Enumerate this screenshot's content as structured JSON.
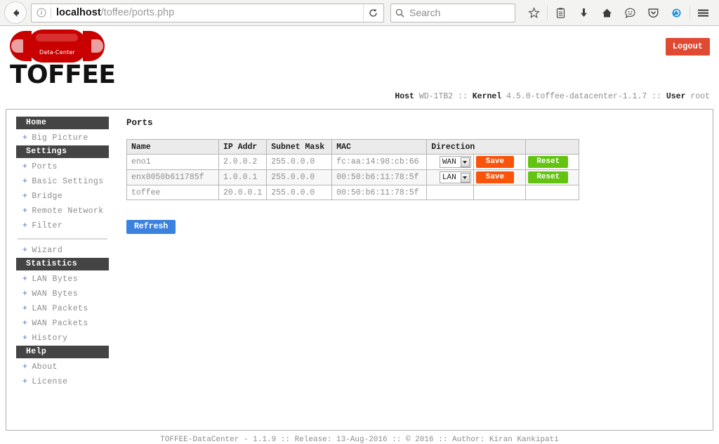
{
  "browser": {
    "back_label": "back-arrow",
    "identity_icon": "info-icon",
    "url_host": "localhost",
    "url_path": "/toffee/ports.php",
    "reload_label": "reload-icon",
    "search_placeholder": "Search",
    "toolbar_icons": [
      {
        "name": "bookmark-star-icon",
        "glyph": "☆"
      },
      {
        "name": "reading-list-icon",
        "glyph": "὜D"
      },
      {
        "name": "downloads-icon",
        "glyph": "↓"
      },
      {
        "name": "home-icon",
        "glyph": "⌂"
      },
      {
        "name": "hello-chat-icon",
        "glyph": "☺"
      },
      {
        "name": "pocket-icon",
        "glyph": "▽"
      },
      {
        "name": "sync-account-icon",
        "glyph": "●"
      },
      {
        "name": "menu-hamburger-icon",
        "glyph": "☰"
      }
    ]
  },
  "header": {
    "logo_label": "Data-Center",
    "logo_word": "TOFFEE",
    "logout_label": "Logout",
    "host_label": "Host",
    "host_value": "WD-1TB2",
    "sep1": "::",
    "kernel_label": "Kernel",
    "kernel_value": "4.5.0-toffee-datacenter-1.1.7",
    "sep2": "::",
    "user_label": "User",
    "user_value": "root"
  },
  "sidebar": {
    "groups": [
      {
        "heading": "Home",
        "items": [
          {
            "label": "Big Picture"
          }
        ]
      },
      {
        "heading": "Settings",
        "items": [
          {
            "label": "Ports"
          },
          {
            "label": "Basic Settings"
          },
          {
            "label": "Bridge"
          },
          {
            "label": "Remote Network"
          },
          {
            "label": "Filter"
          }
        ]
      },
      {
        "heading": null,
        "items": [
          {
            "label": "Wizard"
          }
        ]
      },
      {
        "heading": "Statistics",
        "items": [
          {
            "label": "LAN Bytes"
          },
          {
            "label": "WAN Bytes"
          },
          {
            "label": "LAN Packets"
          },
          {
            "label": "WAN Packets"
          },
          {
            "label": "History"
          }
        ]
      },
      {
        "heading": "Help",
        "items": [
          {
            "label": "About"
          },
          {
            "label": "License"
          }
        ]
      }
    ],
    "expand_marker": "+"
  },
  "main": {
    "title": "Ports",
    "table": {
      "columns": [
        "Name",
        "IP Addr",
        "Subnet Mask",
        "MAC",
        "Direction",
        ""
      ],
      "rows": [
        {
          "name": "eno1",
          "ip": "2.0.0.2",
          "mask": "255.0.0.0",
          "mac": "fc:aa:14:98:cb:66",
          "direction": "WAN",
          "save": "Save",
          "reset": "Reset",
          "has_controls": true
        },
        {
          "name": "enx0050b611785f",
          "ip": "1.0.0.1",
          "mask": "255.0.0.0",
          "mac": "00:50:b6:11:78:5f",
          "direction": "LAN",
          "save": "Save",
          "reset": "Reset",
          "has_controls": true
        },
        {
          "name": "toffee",
          "ip": "20.0.0.1",
          "mask": "255.0.0.0",
          "mac": "00:50:b6:11:78:5f",
          "direction": "",
          "save": "",
          "reset": "",
          "has_controls": false
        }
      ]
    },
    "refresh_label": "Refresh"
  },
  "footer": {
    "text": "TOFFEE-DataCenter - 1.1.9 :: Release: 13-Aug-2016 :: © 2016 :: Author: Kiran Kankipati"
  },
  "colors": {
    "logout": "#e04a33",
    "save": "#f9540a",
    "reset": "#63c311",
    "refresh": "#3b82e0",
    "sidebar_heading": "#444444",
    "logo_red": "#c90000"
  }
}
